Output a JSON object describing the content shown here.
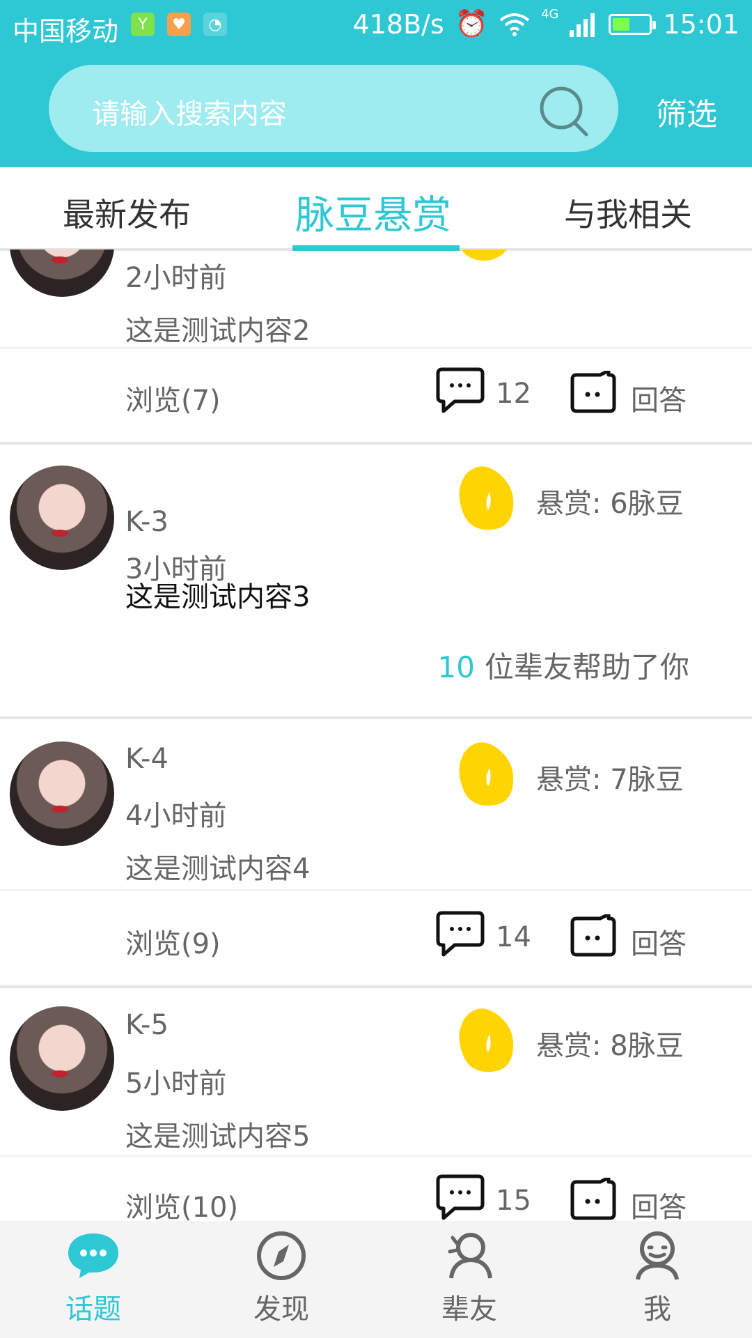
{
  "status_bar": {
    "carrier": "中国移动",
    "net_speed": "418B/s",
    "network": "4G",
    "time": "15:01"
  },
  "search": {
    "placeholder": "请输入搜索内容",
    "filter_label": "筛选"
  },
  "tabs": [
    {
      "label": "最新发布",
      "active": false
    },
    {
      "label": "脉豆悬赏",
      "active": true
    },
    {
      "label": "与我相关",
      "active": false
    }
  ],
  "posts": [
    {
      "time": "2小时前",
      "content": "这是测试内容2",
      "views": "浏览(7)",
      "comments": "12",
      "answer_label": "回答"
    },
    {
      "author": "K-3",
      "time": "3小时前",
      "content": "这是测试内容3",
      "reward": "悬赏: 6脉豆",
      "helped_count": "10",
      "helped_text": "位辈友帮助了你"
    },
    {
      "author": "K-4",
      "time": "4小时前",
      "content": "这是测试内容4",
      "reward": "悬赏: 7脉豆",
      "views": "浏览(9)",
      "comments": "14",
      "answer_label": "回答"
    },
    {
      "author": "K-5",
      "time": "5小时前",
      "content": "这是测试内容5",
      "reward": "悬赏: 8脉豆",
      "views": "浏览(10)",
      "comments": "15",
      "answer_label": "回答"
    }
  ],
  "bottom_nav": [
    {
      "label": "话题",
      "icon": "chat-bubble-icon",
      "active": true
    },
    {
      "label": "发现",
      "icon": "compass-icon",
      "active": false
    },
    {
      "label": "辈友",
      "icon": "friends-icon",
      "active": false
    },
    {
      "label": "我",
      "icon": "profile-icon",
      "active": false
    }
  ],
  "colors": {
    "accent": "#2ec7d4",
    "bean": "#ffd400",
    "text": "#666666"
  }
}
